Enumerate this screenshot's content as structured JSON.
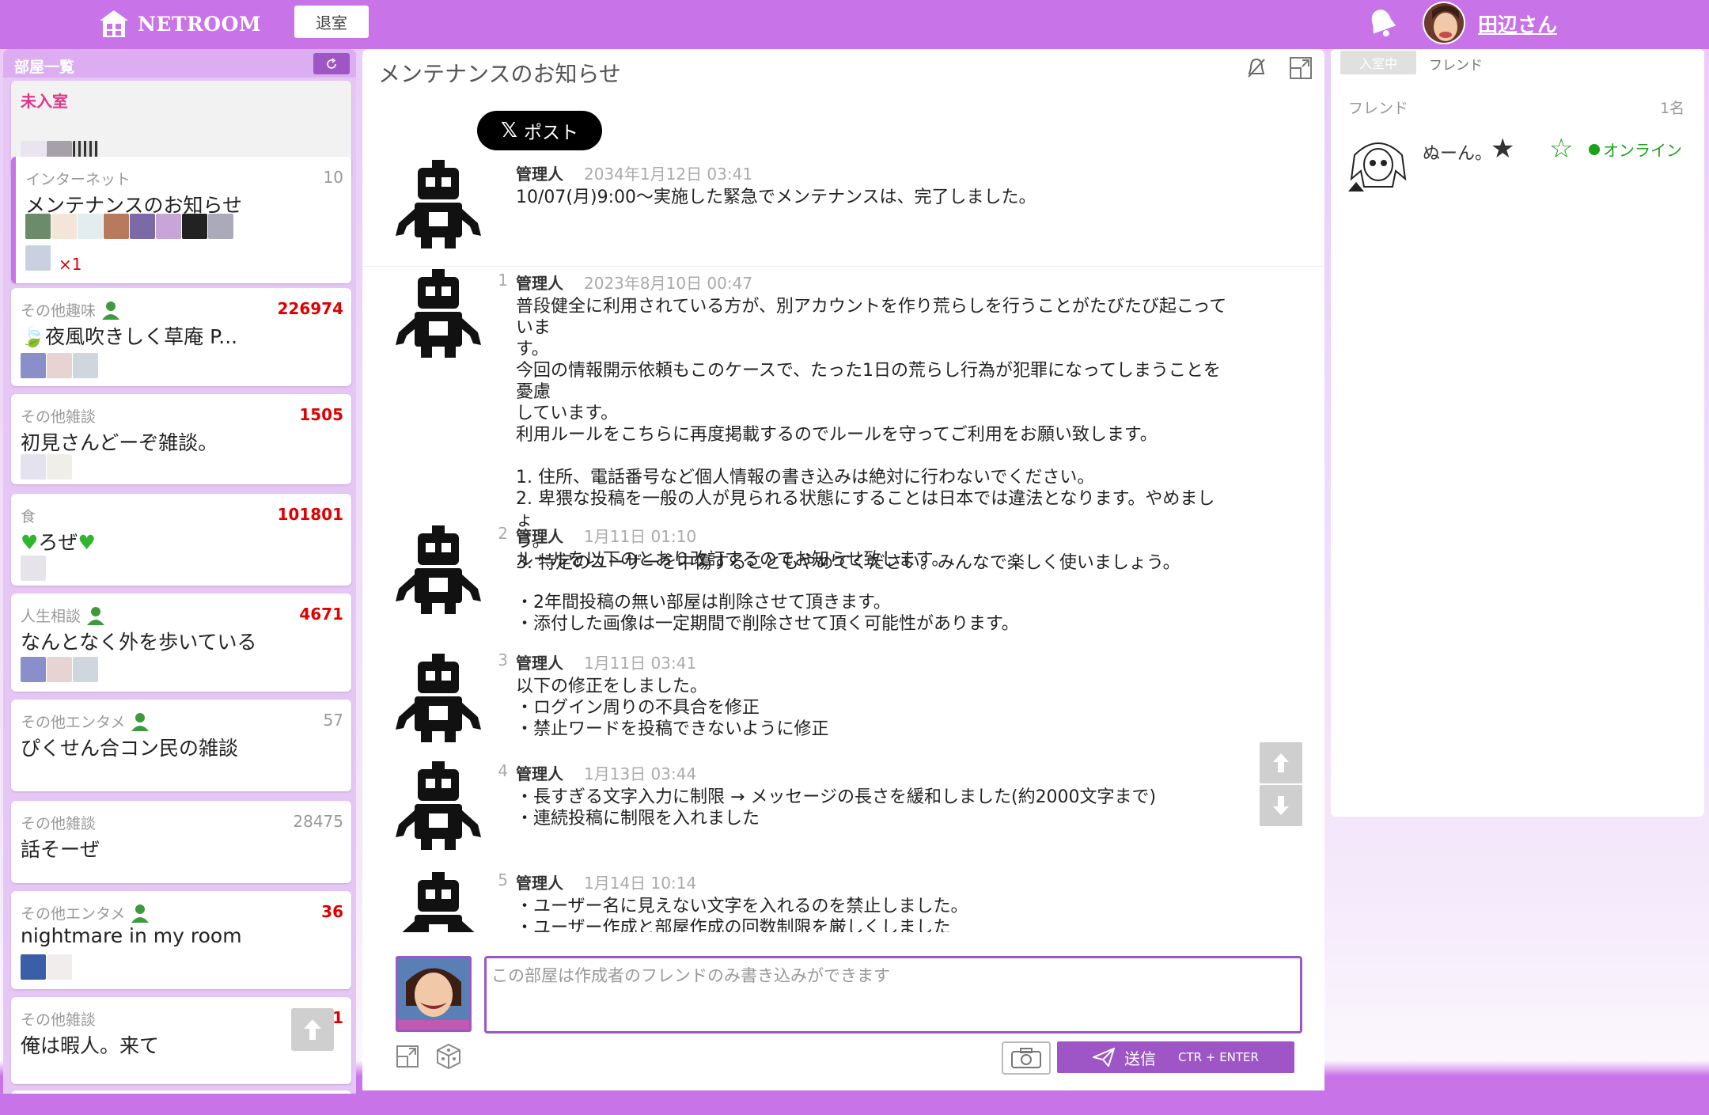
{
  "header": {
    "logo_text": "NETROOM",
    "leave_label": "退室",
    "user_name": "田辺さん"
  },
  "rooms_panel": {
    "title": "部屋一覧",
    "unentered": {
      "label": "未入室"
    },
    "rooms": [
      {
        "category": "インターネット",
        "count": "10",
        "title": "メンテナンスのお知らせ",
        "extra": "×1"
      },
      {
        "category": "その他趣味",
        "count": "226974",
        "title": "夜風吹きしく草庵 P..."
      },
      {
        "category": "その他雑談",
        "count": "1505",
        "title": "初見さんどーぞ雑談。"
      },
      {
        "category": "食",
        "count": "101801",
        "title": "ろぜ"
      },
      {
        "category": "人生相談",
        "count": "4671",
        "title": "なんとなく外を歩いている"
      },
      {
        "category": "その他エンタメ",
        "count": "57",
        "title": "ぴくせん合コン民の雑談"
      },
      {
        "category": "その他雑談",
        "count": "28475",
        "title": "話そーぜ"
      },
      {
        "category": "その他エンタメ",
        "count": "36",
        "title": "nightmare in my room"
      },
      {
        "category": "その他雑談",
        "count": "1",
        "title": "俺は暇人。来て"
      }
    ]
  },
  "chat": {
    "room_title": "メンテナンスのお知らせ",
    "x_post_label": "ポスト",
    "messages": [
      {
        "num": "",
        "author": "管理人",
        "time": "2034年1月12日 03:41",
        "body": "10/07(月)9:00〜実施した緊急でメンテナンスは、完了しました。"
      },
      {
        "num": "1",
        "author": "管理人",
        "time": "2023年8月10日 00:47",
        "body": "普段健全に利用されている方が、別アカウントを作り荒らしを行うことがたびたび起こっていま\nす。\n今回の情報開示依頼もこのケースで、たった1日の荒らし行為が犯罪になってしまうことを憂慮\nしています。\n利用ルールをこちらに再度掲載するのでルールを守ってご利用をお願い致します。\n\n1. 住所、電話番号など個人情報の書き込みは絶対に行わないでください。\n2. 卑猥な投稿を一般の人が見られる状態にすることは日本では違法となります。やめましょ\nう。\n3. 特定のユーザーを中傷することもやめてください。みんなで楽しく使いましょう。"
      },
      {
        "num": "2",
        "author": "管理人",
        "time": "1月11日 01:10",
        "body": "ルールを以下のとおり改訂するのでお知らせ致します。\n\n・2年間投稿の無い部屋は削除させて頂きます。\n・添付した画像は一定期間で削除させて頂く可能性があります。"
      },
      {
        "num": "3",
        "author": "管理人",
        "time": "1月11日 03:41",
        "body": "以下の修正をしました。\n・ログイン周りの不具合を修正\n・禁止ワードを投稿できないように修正"
      },
      {
        "num": "4",
        "author": "管理人",
        "time": "1月13日 03:44",
        "body": "・長すぎる文字入力に制限 → メッセージの長さを緩和しました(約2000文字まで)\n・連続投稿に制限を入れました"
      },
      {
        "num": "5",
        "author": "管理人",
        "time": "1月14日 10:14",
        "body": "・ユーザー名に見えない文字を入れるのを禁止しました。\n・ユーザー作成と部屋作成の回数制限を厳しくしました"
      }
    ]
  },
  "composer": {
    "placeholder": "この部屋は作成者のフレンドのみ書き込みができます",
    "send_label": "送信",
    "send_hint": "CTR + ENTER"
  },
  "friends_panel": {
    "tab_in_room": "入室中",
    "tab_friend": "フレンド",
    "section_label": "フレンド",
    "count": "1名",
    "friends": [
      {
        "name": "ぬーん。",
        "status": "オンライン"
      }
    ]
  },
  "colors": {
    "accent": "#c873e8",
    "accent_dark": "#9e56c6",
    "count_red": "#e00000",
    "online_green": "#1aa11a"
  }
}
